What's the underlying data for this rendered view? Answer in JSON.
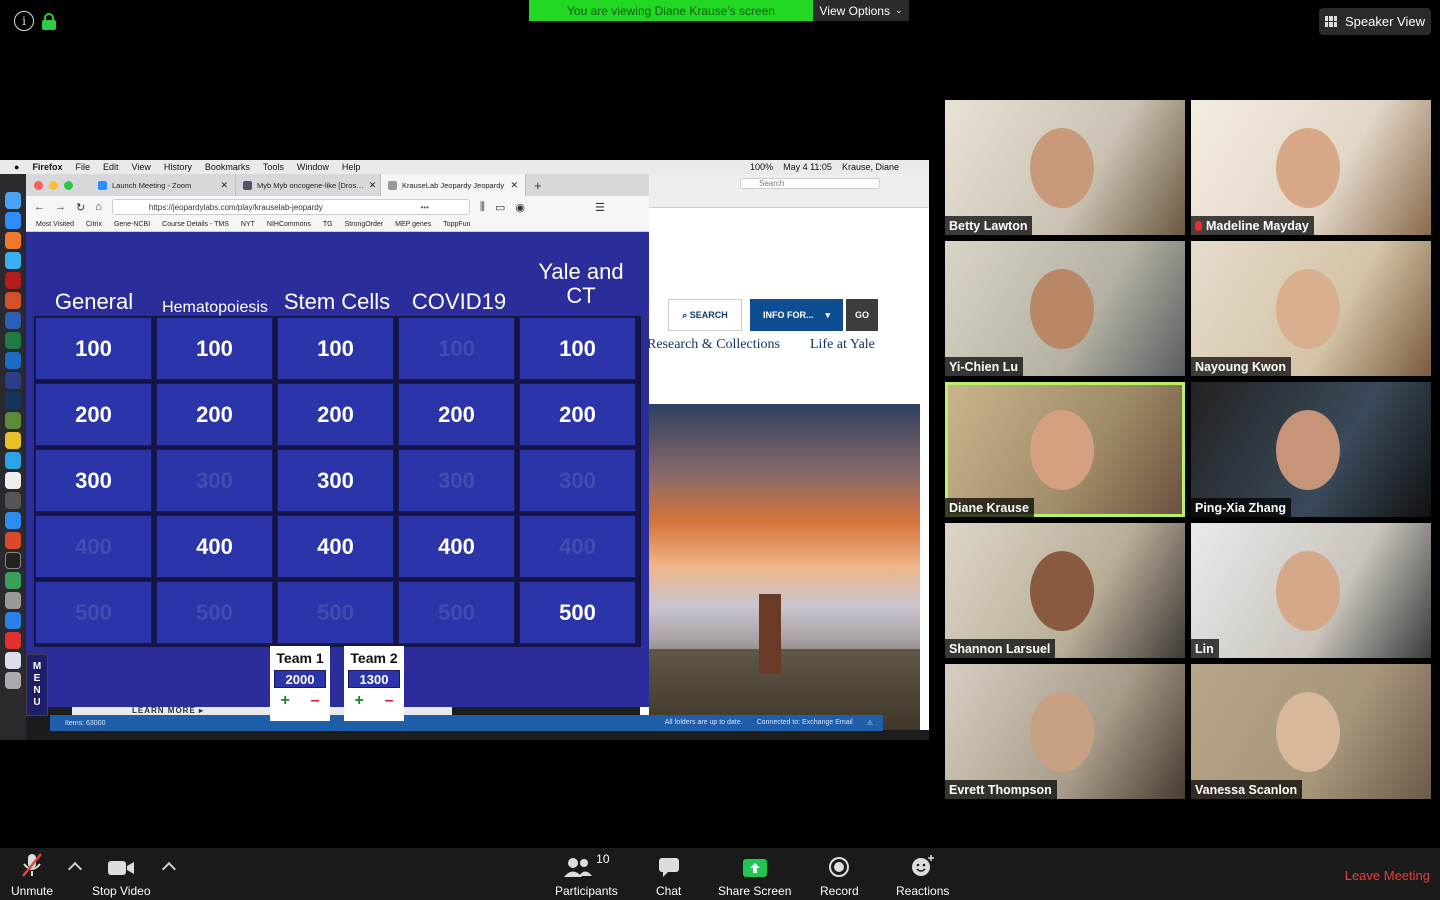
{
  "zoom": {
    "banner_text": "You are viewing Diane Krause's screen",
    "view_options": "View Options",
    "speaker_view": "Speaker View",
    "leave": "Leave Meeting",
    "toolbar": {
      "unmute": "Unmute",
      "stop_video": "Stop Video",
      "participants": "Participants",
      "participants_count": "10",
      "chat": "Chat",
      "share_screen": "Share Screen",
      "record": "Record",
      "reactions": "Reactions"
    },
    "participants": [
      {
        "name": "Betty Lawton",
        "muted": false
      },
      {
        "name": "Madeline Mayday",
        "muted": true
      },
      {
        "name": "Yi-Chien Lu",
        "muted": false
      },
      {
        "name": "Nayoung Kwon",
        "muted": false
      },
      {
        "name": "Diane Krause",
        "muted": false,
        "active_speaker": true
      },
      {
        "name": "Ping-Xia Zhang",
        "muted": false
      },
      {
        "name": "Shannon Larsuel",
        "muted": false
      },
      {
        "name": "Lin",
        "muted": false
      },
      {
        "name": "Evrett Thompson",
        "muted": false
      },
      {
        "name": "Vanessa Scanlon",
        "muted": false
      }
    ]
  },
  "mac": {
    "menubar": [
      "Firefox",
      "File",
      "Edit",
      "View",
      "History",
      "Bookmarks",
      "Tools",
      "Window",
      "Help"
    ],
    "battery": "100%",
    "datetime": "May 4  11:05",
    "user": "Krause, Diane"
  },
  "firefox": {
    "tabs": [
      {
        "title": "Launch Meeting - Zoom",
        "active": false
      },
      {
        "title": "Myb Myb oncogene-like [Dros…",
        "active": false
      },
      {
        "title": "KrauseLab Jeopardy Jeopardy",
        "active": true
      }
    ],
    "url": "https://jeopardylabs.com/play/krauselab-jeopardy",
    "bookmarks": [
      "Most Visited",
      "Citrix",
      "Gene-NCBI",
      "Course Details - TMS",
      "NYT",
      "NIHCommons",
      "TG",
      "StrongOrder",
      "MEP genes",
      "ToppFun"
    ]
  },
  "background_window": {
    "search_placeholder": "Search",
    "search_btn": "SEARCH",
    "info_btn": "INFO FOR...",
    "go_btn": "GO",
    "nav": [
      "Research & Collections",
      "Life at Yale"
    ],
    "learn_more": "LEARN MORE ▸",
    "outlook_items": "Items: 63000",
    "outlook_status1": "All folders are up to date.",
    "outlook_status2": "Connected to: Exchange Email"
  },
  "jeopardy": {
    "categories": [
      "General",
      "Hematopoiesis",
      "Stem Cells",
      "COVID19",
      "Yale and CT"
    ],
    "values": [
      "100",
      "200",
      "300",
      "400",
      "500"
    ],
    "board": [
      [
        true,
        true,
        true,
        false,
        true
      ],
      [
        true,
        true,
        true,
        true,
        true
      ],
      [
        true,
        false,
        true,
        false,
        false
      ],
      [
        false,
        true,
        true,
        true,
        false
      ],
      [
        false,
        false,
        false,
        false,
        true
      ]
    ],
    "menu": "MENU",
    "teams": [
      {
        "name": "Team 1",
        "score": "2000"
      },
      {
        "name": "Team 2",
        "score": "1300"
      }
    ],
    "plus": "+",
    "minus": "–"
  },
  "colors": {
    "board_blue": "#2b34a8",
    "banner_green": "#23d823",
    "active_speaker": "#b9f26a",
    "leave_red": "#e5413a"
  }
}
